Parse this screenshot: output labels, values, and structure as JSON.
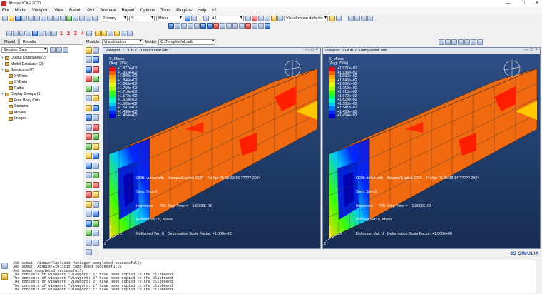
{
  "window": {
    "title": "Abaqus/CAE 2020",
    "controls": [
      "—",
      "☐",
      "✕"
    ]
  },
  "menu": [
    "File",
    "Model",
    "Viewport",
    "View",
    "Result",
    "Plot",
    "Animate",
    "Report",
    "Options",
    "Tools",
    "Plug-ins",
    "Help",
    "k?"
  ],
  "toolbar": {
    "primary_select": "Primary",
    "s_select": "S",
    "mises_select": "Mises",
    "all_select": "All",
    "vis_defaults": "Visualization defaults"
  },
  "view_numbers": [
    "1",
    "2",
    "3",
    "4"
  ],
  "module_bar": {
    "module_label": "Module:",
    "module_value": "Visualization",
    "model_label": "Model:",
    "model_value": "C:/Temp/defult.odb"
  },
  "left_panel": {
    "tabs": [
      "Model",
      "Results"
    ],
    "session_select": "Session Data",
    "tree": [
      {
        "label": "Output Databases (2)",
        "exp": "+",
        "indent": false
      },
      {
        "label": "Model Database (2)",
        "exp": "+",
        "indent": false
      },
      {
        "label": "Spectrums (7)",
        "exp": "+",
        "indent": false
      },
      {
        "label": "XYPlots",
        "exp": "",
        "indent": true
      },
      {
        "label": "XYData",
        "exp": "",
        "indent": true
      },
      {
        "label": "Paths",
        "exp": "",
        "indent": true
      },
      {
        "label": "Display Groups (1)",
        "exp": "+",
        "indent": false
      },
      {
        "label": "Free Body Cuts",
        "exp": "",
        "indent": true
      },
      {
        "label": "Streams",
        "exp": "",
        "indent": true
      },
      {
        "label": "Movies",
        "exp": "",
        "indent": true
      },
      {
        "label": "Images",
        "exp": "",
        "indent": true
      }
    ]
  },
  "viewports": [
    {
      "title": "Viewport: 1   ODB: C:/Temp/vumat.odb",
      "legend_title": "S, Mises",
      "legend_sub": "(Avg: 75%)",
      "values": [
        "+1.977e+02",
        "+1.933e+02",
        "+1.890e+02",
        "+1.846e+02",
        "+1.803e+02",
        "+1.759e+02",
        "+1.716e+02",
        "+1.672e+02",
        "+1.628e+02",
        "+1.585e+02",
        "+1.541e+02",
        "+1.498e+02",
        "+1.454e+02"
      ],
      "odb_line": "ODB: vumat.odb    Abaqus/Explicit 2020    Fri Apr 05 05:33:16 ????? 2024",
      "step_line": "Step: Step-1",
      "incr_line": "Increment      766: Step Time =    1.0000E-03",
      "primary_line": "Primary Var: S, Mises",
      "deformed_line": "Deformed Var: U   Deformation Scale Factor: +1.000e+00"
    },
    {
      "title": "Viewport: 2   ODB: C:/Temp/defult.odb",
      "legend_title": "S, Mises",
      "legend_sub": "(Avg: 75%)",
      "values": [
        "+1.977e+02",
        "+1.933e+02",
        "+1.890e+02",
        "+1.846e+02",
        "+1.802e+02",
        "+1.759e+02",
        "+1.715e+02",
        "+1.672e+02",
        "+1.628e+02",
        "+1.585e+02",
        "+1.541e+02",
        "+1.498e+02",
        "+1.454e+02"
      ],
      "odb_line": "ODB: defult.odb    Abaqus/Explicit 2020    Fri Apr 05 05:28:14 ????? 2024",
      "step_line": "Step: Step-1",
      "incr_line": "Increment      765: Step Time =    1.0000E-03",
      "primary_line": "Primary Var: S, Mises",
      "deformed_line": "Deformed Var: U   Deformation Scale Factor: +1.000e+00"
    }
  ],
  "legend_colors": [
    "#ff0000",
    "#ff5a00",
    "#ffa500",
    "#ffd200",
    "#e6ff00",
    "#9bff00",
    "#3cff00",
    "#00ff5a",
    "#00ffc8",
    "#00c8ff",
    "#0078ff",
    "#0028ff",
    "#0000dc"
  ],
  "messages": "Job vumat: Abaqus/Explicit Packager completed successfully\nJob vumat: Abaqus/Explicit completed successfully\nJob vumat completed successfully\nThe contents of viewport \"Viewport: 1\" have been copied to the clipboard\nThe contents of viewport \"Viewport: 2\" have been copied to the clipboard\nThe contents of viewport \"Viewport: 2\" have been copied to the clipboard\nThe contents of viewport \"Viewport: 1\" have been copied to the clipboard\nThe contents of viewport \"Viewport: 1\" have been copied to the clipboard",
  "brand": "3S SIMULIA"
}
